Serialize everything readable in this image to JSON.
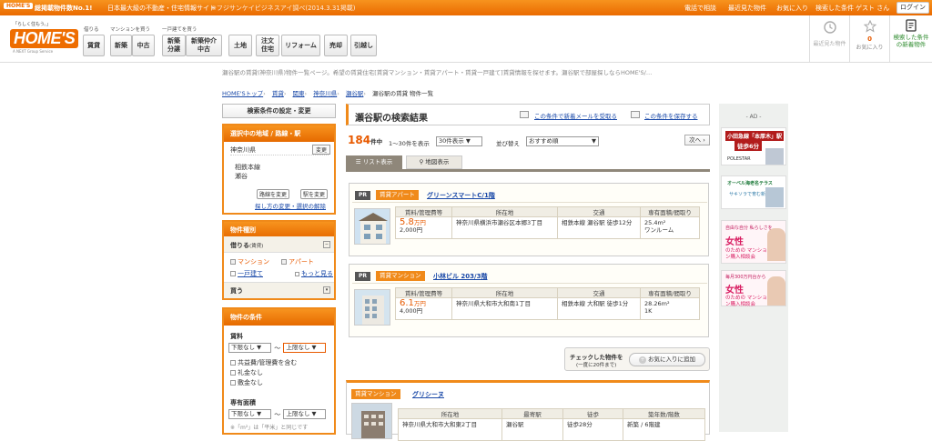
{
  "topbar": {
    "logo": "HOME'S",
    "promo_label": "総掲載物件数No.1!",
    "promo_text": "日本最大級の不動産・住宅情報サイト",
    "promo_note": "※フジサンケイビジネスアイ調べ(2014.3.31掲載)",
    "links": [
      "電話で相談",
      "最近見た物件",
      "お気に入り",
      "検索した条件"
    ],
    "user": "ゲスト さん",
    "login": "ログイン"
  },
  "header": {
    "logo_tagline": "「らしく住もう。」",
    "logo": "HOME'S",
    "logo_sub": "A NEXT Group Service",
    "nav_groups": [
      {
        "label": "借りる",
        "buttons": [
          "賃貸"
        ]
      },
      {
        "label": "マンションを買う",
        "buttons": [
          "新築",
          "中古"
        ]
      },
      {
        "label": "一戸建てを買う",
        "buttons": [
          "新築\n分譲",
          "新築仲介\n中古"
        ]
      },
      {
        "label": "",
        "buttons": [
          "土地",
          "注文\n住宅",
          "リフォーム",
          "売却",
          "引越し"
        ]
      }
    ],
    "icons": [
      {
        "label": "最近見た物件",
        "count": ""
      },
      {
        "label": "お気に入り",
        "count": "0"
      },
      {
        "label": "検索した条件の新着物件",
        "count": ""
      }
    ]
  },
  "description": "瀬谷駅の賃貸(神奈川県)物件一覧ページ。希望の賃貸住宅[賃貸マンション・賃貸アパート・賃貸一戸建て]賃貸情報を探せます。瀬谷駅で部屋探しならHOME'S/…",
  "breadcrumb": [
    "HOME'Sトップ",
    "賃貸",
    "関東",
    "神奈川県",
    "瀬谷駅",
    "瀬谷駅の賃貸 物件一覧"
  ],
  "sidebar": {
    "settings_btn": "検索条件の設定・変更",
    "area_head": "選択中の地域 / 路線・駅",
    "prefecture": "神奈川県",
    "change": "変更",
    "line": "相鉄本線",
    "station": "瀬谷",
    "line_change": "路線を変更",
    "station_change": "駅を変更",
    "other_link": "探し方の変更・選択の解除",
    "type_head": "物件種別",
    "rent_label": "借りる",
    "rent_sub": "(賃貸)",
    "types": [
      {
        "label": "マンション",
        "checked": true
      },
      {
        "label": "アパート",
        "checked": true
      },
      {
        "label": "一戸建て",
        "checked": false
      }
    ],
    "more": "もっと見る",
    "buy_label": "買う",
    "cond_head": "物件の条件",
    "rent_price": "賃料",
    "min": "下限なし",
    "max": "上限なし",
    "include_fee": "共益費/管理費を含む",
    "no_deposit": "礼金なし",
    "no_key": "敷金なし",
    "area_label": "専有面積",
    "area_min": "下限なし",
    "area_max": "上限なし",
    "area_note": "※「m²」は「平米」と同じです"
  },
  "results": {
    "title": "瀬谷駅の検索結果",
    "mail_link": "この条件で新着メールを受取る",
    "save_link": "この条件を保存する",
    "count": "184",
    "count_unit": "件中",
    "range": "1〜30件を表示",
    "per_page": "30件表示",
    "sort_label": "並び替え",
    "sort": "おすすめ順",
    "next": "次へ",
    "tab_list": "リスト表示",
    "tab_map": "地図表示"
  },
  "columns": [
    "賃料/管理費等",
    "所在地",
    "交通",
    "専有面積/間取り"
  ],
  "properties": [
    {
      "pr": "PR",
      "type": "賃貸アパート",
      "name": "グリーンスマートC/1階",
      "rent": "5.8",
      "rent_unit": "万円",
      "fee": "2,000円",
      "address": "神奈川県横浜市瀬谷区本郷3丁目",
      "access": "相鉄本線 瀬谷駅 徒歩12分",
      "area": "25.4m²",
      "layout": "ワンルーム"
    },
    {
      "pr": "PR",
      "type": "賃貸マンション",
      "name": "小林ビル 203/3階",
      "rent": "6.1",
      "rent_unit": "万円",
      "fee": "4,000円",
      "address": "神奈川県大和市大和南1丁目",
      "access": "相鉄本線 大和駅 徒歩1分",
      "area": "28.26m²",
      "layout": "1K"
    }
  ],
  "check_box": {
    "label": "チェックした物件を",
    "sub": "(一度に20件まで)",
    "button": "お気に入りに追加"
  },
  "property3": {
    "type": "賃貸マンション",
    "name": "グリシーヌ",
    "columns": [
      "所在地",
      "最寄駅",
      "徒歩",
      "築年数/階数"
    ],
    "address": "神奈川県大和市大和東2丁目",
    "station": "瀬谷駅",
    "walk": "徒歩28分",
    "age": "新築 / 6階建"
  },
  "ads": {
    "label": "- AD -",
    "items": [
      {
        "title": "小田急線「本厚木」駅",
        "sub": "徒歩6分",
        "brand": "POLESTAR"
      },
      {
        "title": "オーベル海老名テラス",
        "sub": "サキソラで育む新生活",
        "brand": ""
      },
      {
        "title": "女性",
        "sub": "のための マンション購入相談会",
        "brand": "自由な自分 私らしさを"
      },
      {
        "title": "女性",
        "sub": "のための マンション購入相談会",
        "brand": "毎月300万円台から"
      }
    ]
  },
  "colors": {
    "accent": "#ee6d00",
    "link": "#1a49a8",
    "price": "#e85a00"
  }
}
